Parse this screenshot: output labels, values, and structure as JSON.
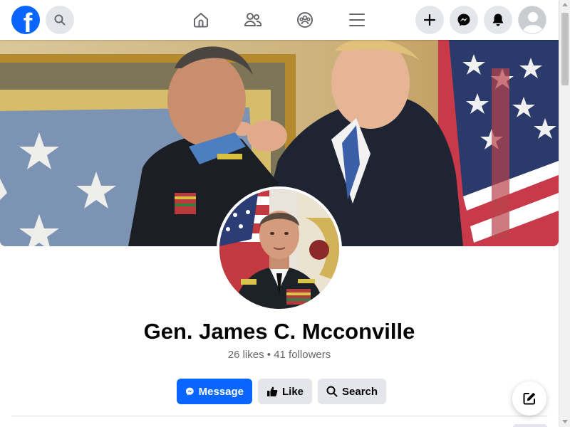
{
  "header": {
    "logo_letter": "f",
    "nav": [
      {
        "name": "home",
        "icon": "home-icon"
      },
      {
        "name": "friends",
        "icon": "friends-icon"
      },
      {
        "name": "groups",
        "icon": "groups-icon"
      },
      {
        "name": "menu",
        "icon": "menu-icon"
      }
    ],
    "right": [
      {
        "name": "create",
        "icon": "plus-icon"
      },
      {
        "name": "messenger",
        "icon": "messenger-icon"
      },
      {
        "name": "notifications",
        "icon": "bell-icon"
      },
      {
        "name": "account",
        "icon": "avatar-icon"
      }
    ]
  },
  "profile": {
    "name": "Gen. James C. Mcconville",
    "stats": "26 likes • 41 followers"
  },
  "actions": {
    "message_label": "Message",
    "like_label": "Like",
    "search_label": "Search"
  },
  "colors": {
    "brand": "#0866ff",
    "secondary_bg": "#e4e6eb",
    "text": "#050505",
    "muted": "#65676b"
  }
}
